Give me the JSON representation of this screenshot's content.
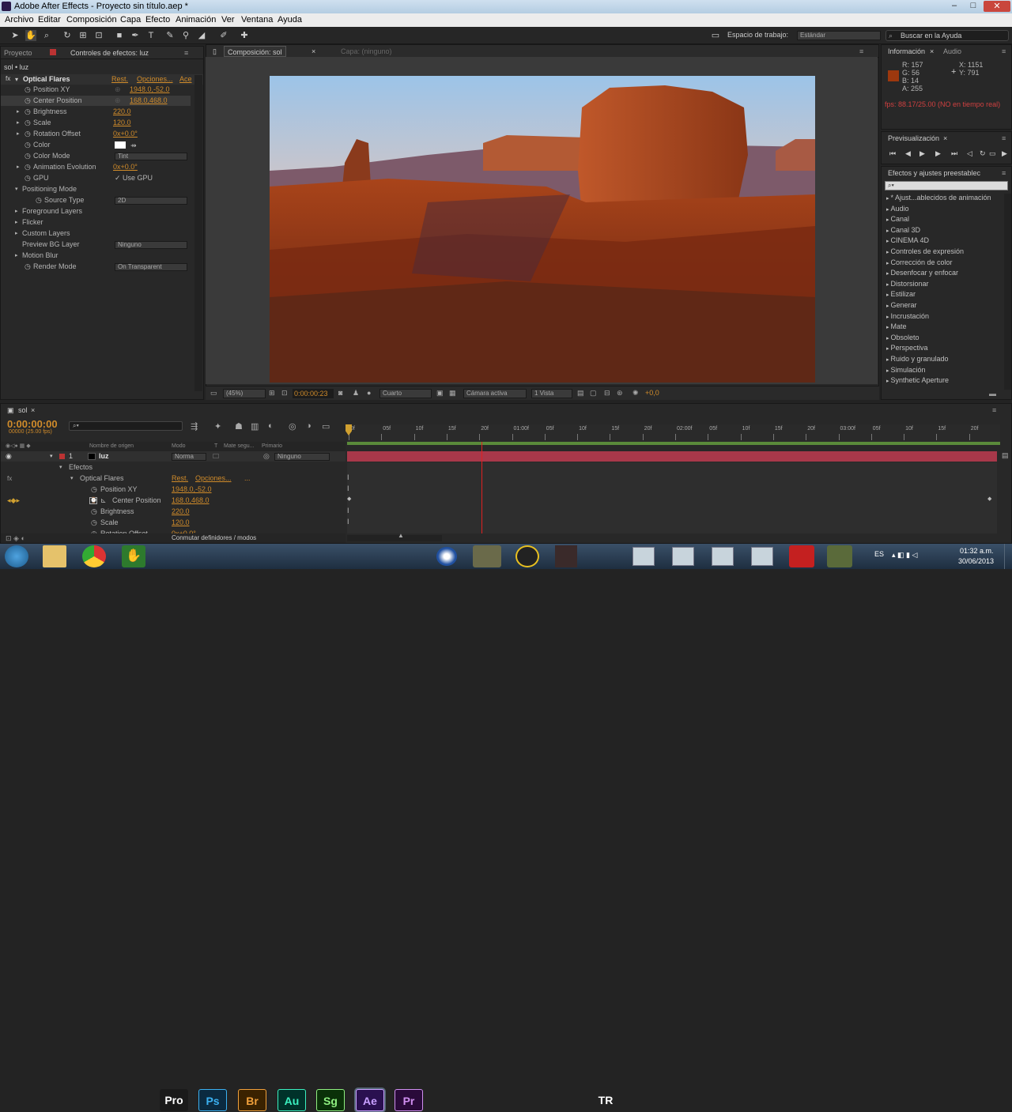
{
  "window": {
    "title": "Adobe After Effects - Proyecto sin título.aep *"
  },
  "menu": [
    "Archivo",
    "Editar",
    "Composición",
    "Capa",
    "Efecto",
    "Animación",
    "Ver",
    "Ventana",
    "Ayuda"
  ],
  "workspace": {
    "label": "Espacio de trabajo:",
    "value": "Estándar",
    "search_placeholder": "Buscar en la Ayuda"
  },
  "left_panel": {
    "tab_project": "Proyecto",
    "tab_effects": "Controles de efectos: luz",
    "breadcrumb": "sol • luz",
    "effect_name": "Optical Flares",
    "reset": "Rest.",
    "options": "Opciones...",
    "about": "Ace",
    "rows": [
      {
        "label": "Position XY",
        "value": "1948.0,-52.0"
      },
      {
        "label": "Center Position",
        "value": "168.0,468.0"
      },
      {
        "label": "Brightness",
        "value": "220.0"
      },
      {
        "label": "Scale",
        "value": "120.0"
      },
      {
        "label": "Rotation Offset",
        "value": "0x+0.0°"
      },
      {
        "label": "Color",
        "value": ""
      },
      {
        "label": "Color Mode",
        "value": "Tint"
      },
      {
        "label": "Animation Evolution",
        "value": "0x+0.0°"
      },
      {
        "label": "GPU",
        "value": "Use GPU"
      },
      {
        "label": "Positioning Mode",
        "value": ""
      },
      {
        "label": "Source Type",
        "value": "2D"
      },
      {
        "label": "Foreground Layers",
        "value": ""
      },
      {
        "label": "Flicker",
        "value": ""
      },
      {
        "label": "Custom Layers",
        "value": ""
      },
      {
        "label": "Preview BG Layer",
        "value": "Ninguno"
      },
      {
        "label": "Motion Blur",
        "value": ""
      },
      {
        "label": "Render Mode",
        "value": "On Transparent"
      }
    ]
  },
  "composition": {
    "tab": "Composición: sol",
    "layer_tab": "Capa: (ninguno)",
    "breadcrumb": "sol",
    "zoom": "(45%)",
    "timecode": "0:00:00:23",
    "resolution": "Cuarto",
    "camera": "Cámara activa",
    "views": "1 Vista",
    "exposure": "+0,0"
  },
  "info_panel": {
    "tab_info": "Información",
    "tab_audio": "Audio",
    "r": "R: 157",
    "g": "G: 56",
    "b": "B: 14",
    "a": "A: 255",
    "x": "X: 1151",
    "y": "Y: 791",
    "fps": "fps: 88.17/25.00 (NO en tiempo real)",
    "swatch_color": "#9d380e"
  },
  "preview": {
    "tab": "Previsualización"
  },
  "effects_presets": {
    "tab": "Efectos y ajustes preestablec",
    "items": [
      "* Ajust...ablecidos de animación",
      "Audio",
      "Canal",
      "Canal 3D",
      "CINEMA 4D",
      "Controles de expresión",
      "Corrección de color",
      "Desenfocar y enfocar",
      "Distorsionar",
      "Estilizar",
      "Generar",
      "Incrustación",
      "Mate",
      "Obsoleto",
      "Perspectiva",
      "Ruido y granulado",
      "Simulación",
      "Synthetic Aperture"
    ]
  },
  "timeline": {
    "tab": "sol",
    "timecode": "0:00:00:00",
    "fps": "00000 (25.00 fps)",
    "columns": {
      "source": "Nombre de origen",
      "mode": "Modo",
      "t": "T",
      "matte": "Mate segu...",
      "parent": "Primario"
    },
    "layer": {
      "index": "1",
      "name": "luz",
      "mode": "Norma",
      "parent": "Ninguno"
    },
    "effects_label": "Efectos",
    "optical": "Optical Flares",
    "reset": "Rest.",
    "options": "Opciones...",
    "dots": "...",
    "props": [
      {
        "label": "Position XY",
        "value": "1948.0,-52.0"
      },
      {
        "label": "Center Position",
        "value": "168.0,468.0"
      },
      {
        "label": "Brightness",
        "value": "220.0"
      },
      {
        "label": "Scale",
        "value": "120.0"
      },
      {
        "label": "Rotation Offset",
        "value": "0x+0.0°"
      }
    ],
    "toggle": "Conmutar definidores / modos",
    "ruler": [
      "0f",
      "05f",
      "10f",
      "15f",
      "20f",
      "01:00f",
      "05f",
      "10f",
      "15f",
      "20f",
      "02:00f",
      "05f",
      "10f",
      "15f",
      "20f",
      "03:00f",
      "05f",
      "10f",
      "15f",
      "20f"
    ]
  },
  "taskbar": {
    "apps": [
      "Pro",
      "Ps",
      "Br",
      "Au",
      "Sg",
      "Ae",
      "Pr",
      "TR"
    ],
    "lang": "ES",
    "time": "01:32 a.m.",
    "date": "30/06/2013"
  }
}
